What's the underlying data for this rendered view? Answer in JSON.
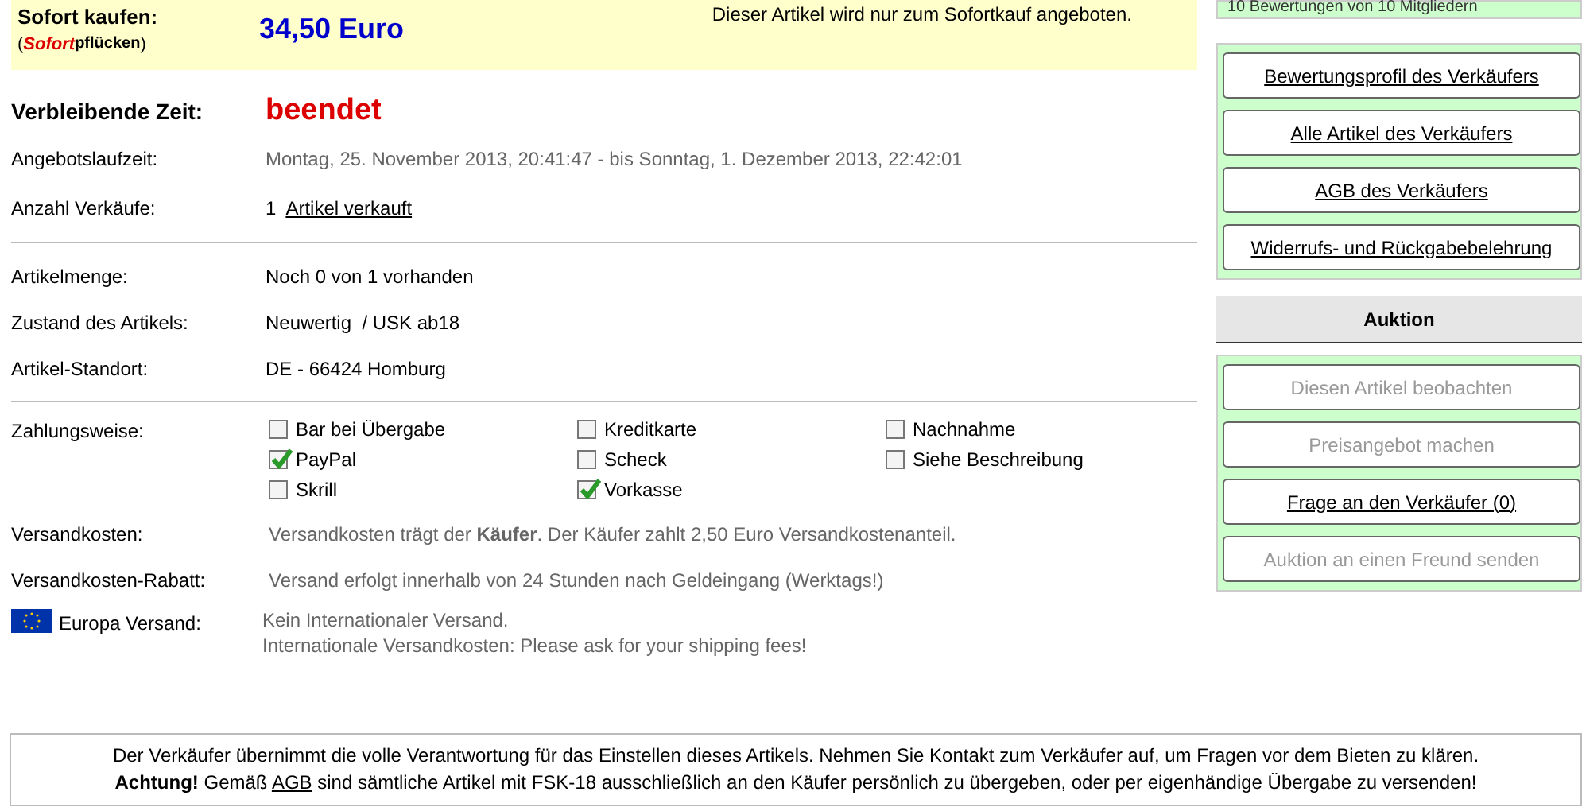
{
  "buy_now": {
    "label": "Sofort kaufen:",
    "brand_open": "(",
    "brand": "Sofort",
    "brand_suffix": "pflücken",
    "brand_close": ")",
    "price": "34,50 Euro",
    "note": "Dieser Artikel wird nur zum Sofortkauf angeboten."
  },
  "remaining": {
    "label": "Verbleibende Zeit:",
    "value": "beendet"
  },
  "details": [
    {
      "label": "Angebotslaufzeit:",
      "value": "Montag, 25. November 2013, 20:41:47 - bis Sonntag, 1. Dezember 2013, 22:42:01",
      "kind": "grey"
    },
    {
      "label": "Anzahl Verkäufe:",
      "count": "1",
      "link": "Artikel verkauft",
      "kind": "link"
    }
  ],
  "item": [
    {
      "label": "Artikelmenge:",
      "value": "Noch 0 von 1 vorhanden"
    },
    {
      "label": "Zustand des Artikels:",
      "value": "Neuwertig  / USK ab18"
    },
    {
      "label": "Artikel-Standort:",
      "value": "DE - 66424 Homburg"
    }
  ],
  "payment": {
    "label": "Zahlungsweise:",
    "columns": [
      [
        {
          "label": "Bar bei Übergabe",
          "checked": false
        },
        {
          "label": "PayPal",
          "checked": true
        },
        {
          "label": "Skrill",
          "checked": false
        }
      ],
      [
        {
          "label": "Kreditkarte",
          "checked": false
        },
        {
          "label": "Scheck",
          "checked": false
        },
        {
          "label": "Vorkasse",
          "checked": true
        }
      ],
      [
        {
          "label": "Nachnahme",
          "checked": false
        },
        {
          "label": "Siehe Beschreibung",
          "checked": false
        }
      ]
    ]
  },
  "shipping": [
    {
      "label": "Versandkosten:",
      "text": "Versandkosten trägt der **Käufer**. Der Käufer zahlt 2,50 Euro Versandkostenanteil."
    },
    {
      "label": "Versandkosten-Rabatt:",
      "text": "Versand erfolgt innerhalb von 24 Stunden nach Geldeingang (Werktags!)"
    }
  ],
  "europe": {
    "label": "Europa Versand:",
    "lines": [
      "Kein Internationaler Versand.",
      "Internationale Versandkosten: Please ask for your shipping fees!"
    ]
  },
  "notice": {
    "line1": "Der Verkäufer übernimmt die volle Verantwortung für das Einstellen dieses Artikels. Nehmen Sie Kontakt zum Verkäufer auf, um Fragen vor dem Bieten zu klären.",
    "line2_before": "**Achtung!** Gemäß",
    "line2_link": "AGB",
    "line2_after": "sind sämtliche Artikel mit FSK-18 ausschließlich an den Käufer persönlich zu übergeben, oder per eigenhändige Übergabe zu versenden!"
  },
  "sidebar": {
    "ratings": "10 Bewertungen von 10 Mitgliedern",
    "seller_buttons": [
      {
        "label": "Bewertungsprofil des Verkäufers",
        "disabled": false
      },
      {
        "label": "Alle Artikel des Verkäufers",
        "disabled": false
      },
      {
        "label": "AGB des Verkäufers",
        "disabled": false
      },
      {
        "label": "Widerrufs- und Rückgabebelehrung",
        "disabled": false
      }
    ],
    "auction_title": "Auktion",
    "auction_buttons": [
      {
        "label": "Diesen Artikel beobachten",
        "disabled": true
      },
      {
        "label": "Preisangebot machen",
        "disabled": true
      },
      {
        "label": "Frage an den Verkäufer (0)",
        "disabled": false
      },
      {
        "label": "Auktion an einen Freund senden",
        "disabled": true
      }
    ]
  }
}
